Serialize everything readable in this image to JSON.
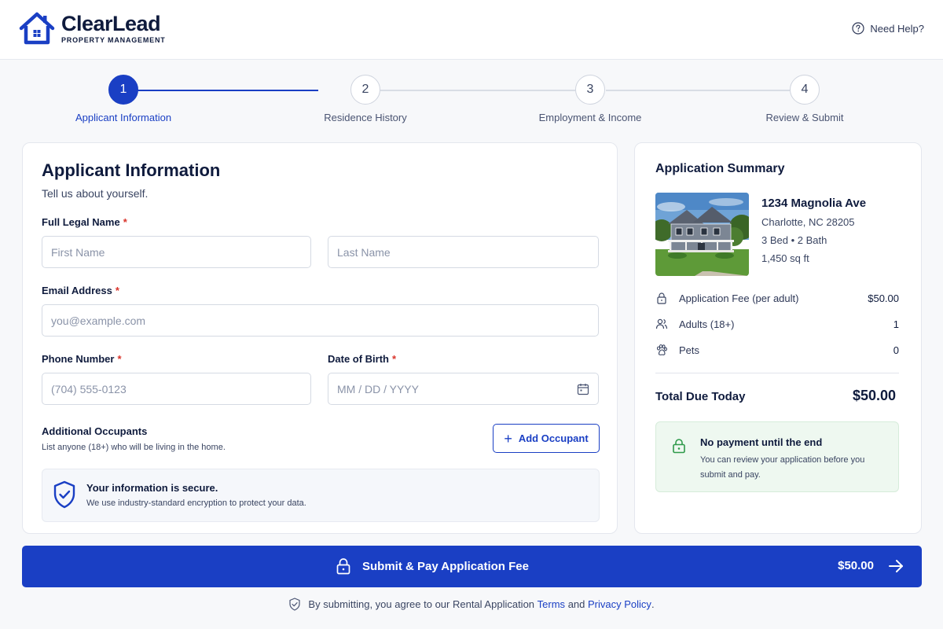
{
  "brand": {
    "name": "ClearLead",
    "subtitle": "PROPERTY MANAGEMENT",
    "color": "#1a3fc4"
  },
  "header": {
    "help_label": "Need Help?"
  },
  "stepper": {
    "steps": [
      {
        "number": "1",
        "label": "Applicant Information"
      },
      {
        "number": "2",
        "label": "Residence History"
      },
      {
        "number": "3",
        "label": "Employment & Income"
      },
      {
        "number": "4",
        "label": "Review & Submit"
      }
    ],
    "active_step": 1
  },
  "form": {
    "title": "Applicant Information",
    "subtitle": "Tell us about yourself.",
    "required_mark": "*",
    "full_name": {
      "label": "Full Legal Name",
      "first_placeholder": "First Name",
      "last_placeholder": "Last Name"
    },
    "email": {
      "label": "Email Address",
      "placeholder": "you@example.com"
    },
    "phone": {
      "label": "Phone Number",
      "placeholder": "(704) 555-0123"
    },
    "dob": {
      "label": "Date of Birth",
      "placeholder": "MM / DD / YYYY"
    },
    "occupants": {
      "title": "Additional Occupants",
      "subtitle": "List anyone (18+) who will be living in the home.",
      "add_label": "Add Occupant",
      "add_symbol": "+"
    },
    "secure": {
      "title": "Your information is secure.",
      "subtitle": "We use industry-standard encryption to protect your data."
    }
  },
  "summary": {
    "title": "Application Summary",
    "property": {
      "address": "1234 Magnolia Ave",
      "city": "Charlotte, NC 28205",
      "beds_baths": "3 Bed • 2 Bath",
      "size": "1,450 sq ft"
    },
    "rows": [
      {
        "icon": "lock-icon",
        "label": "Application Fee (per adult)",
        "value": "$50.00"
      },
      {
        "icon": "people-icon",
        "label": "Adults (18+)",
        "value": "1"
      },
      {
        "icon": "paw-icon",
        "label": "Pets",
        "value": "0"
      }
    ],
    "total_label": "Total Due Today",
    "total_value": "$50.00",
    "notice": {
      "title": "No payment until the end",
      "text": "You can review your application before you submit and pay."
    }
  },
  "submit": {
    "label": "Submit & Pay Application Fee",
    "amount": "$50.00"
  },
  "footer": {
    "prefix": "By submitting, you agree to our Rental Application",
    "terms": "Terms",
    "and": "and",
    "privacy": "Privacy Policy",
    "suffix": "."
  }
}
